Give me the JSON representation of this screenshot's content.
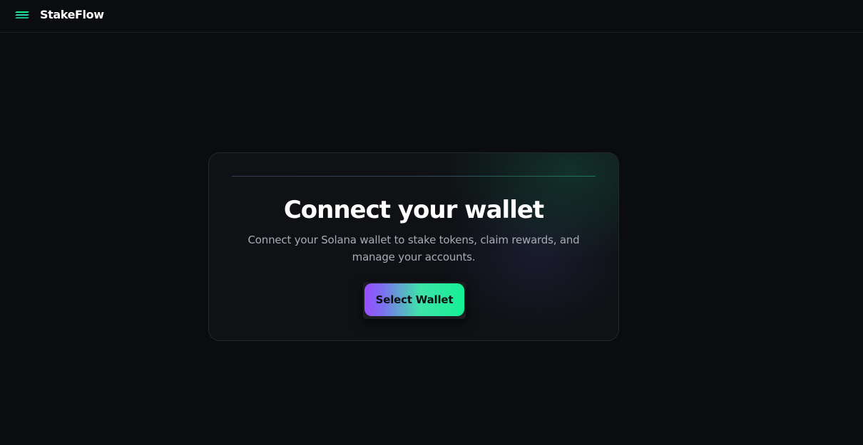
{
  "header": {
    "brand": "StakeFlow",
    "logo_icon": "stacked-lines-logo-icon",
    "accent": "#14f195"
  },
  "connect_card": {
    "title": "Connect your wallet",
    "description": "Connect your Solana wallet to stake tokens, claim rewards, and manage your accounts.",
    "button_label": "Select Wallet",
    "button_gradient": [
      "#9945ff",
      "#14f195"
    ]
  }
}
